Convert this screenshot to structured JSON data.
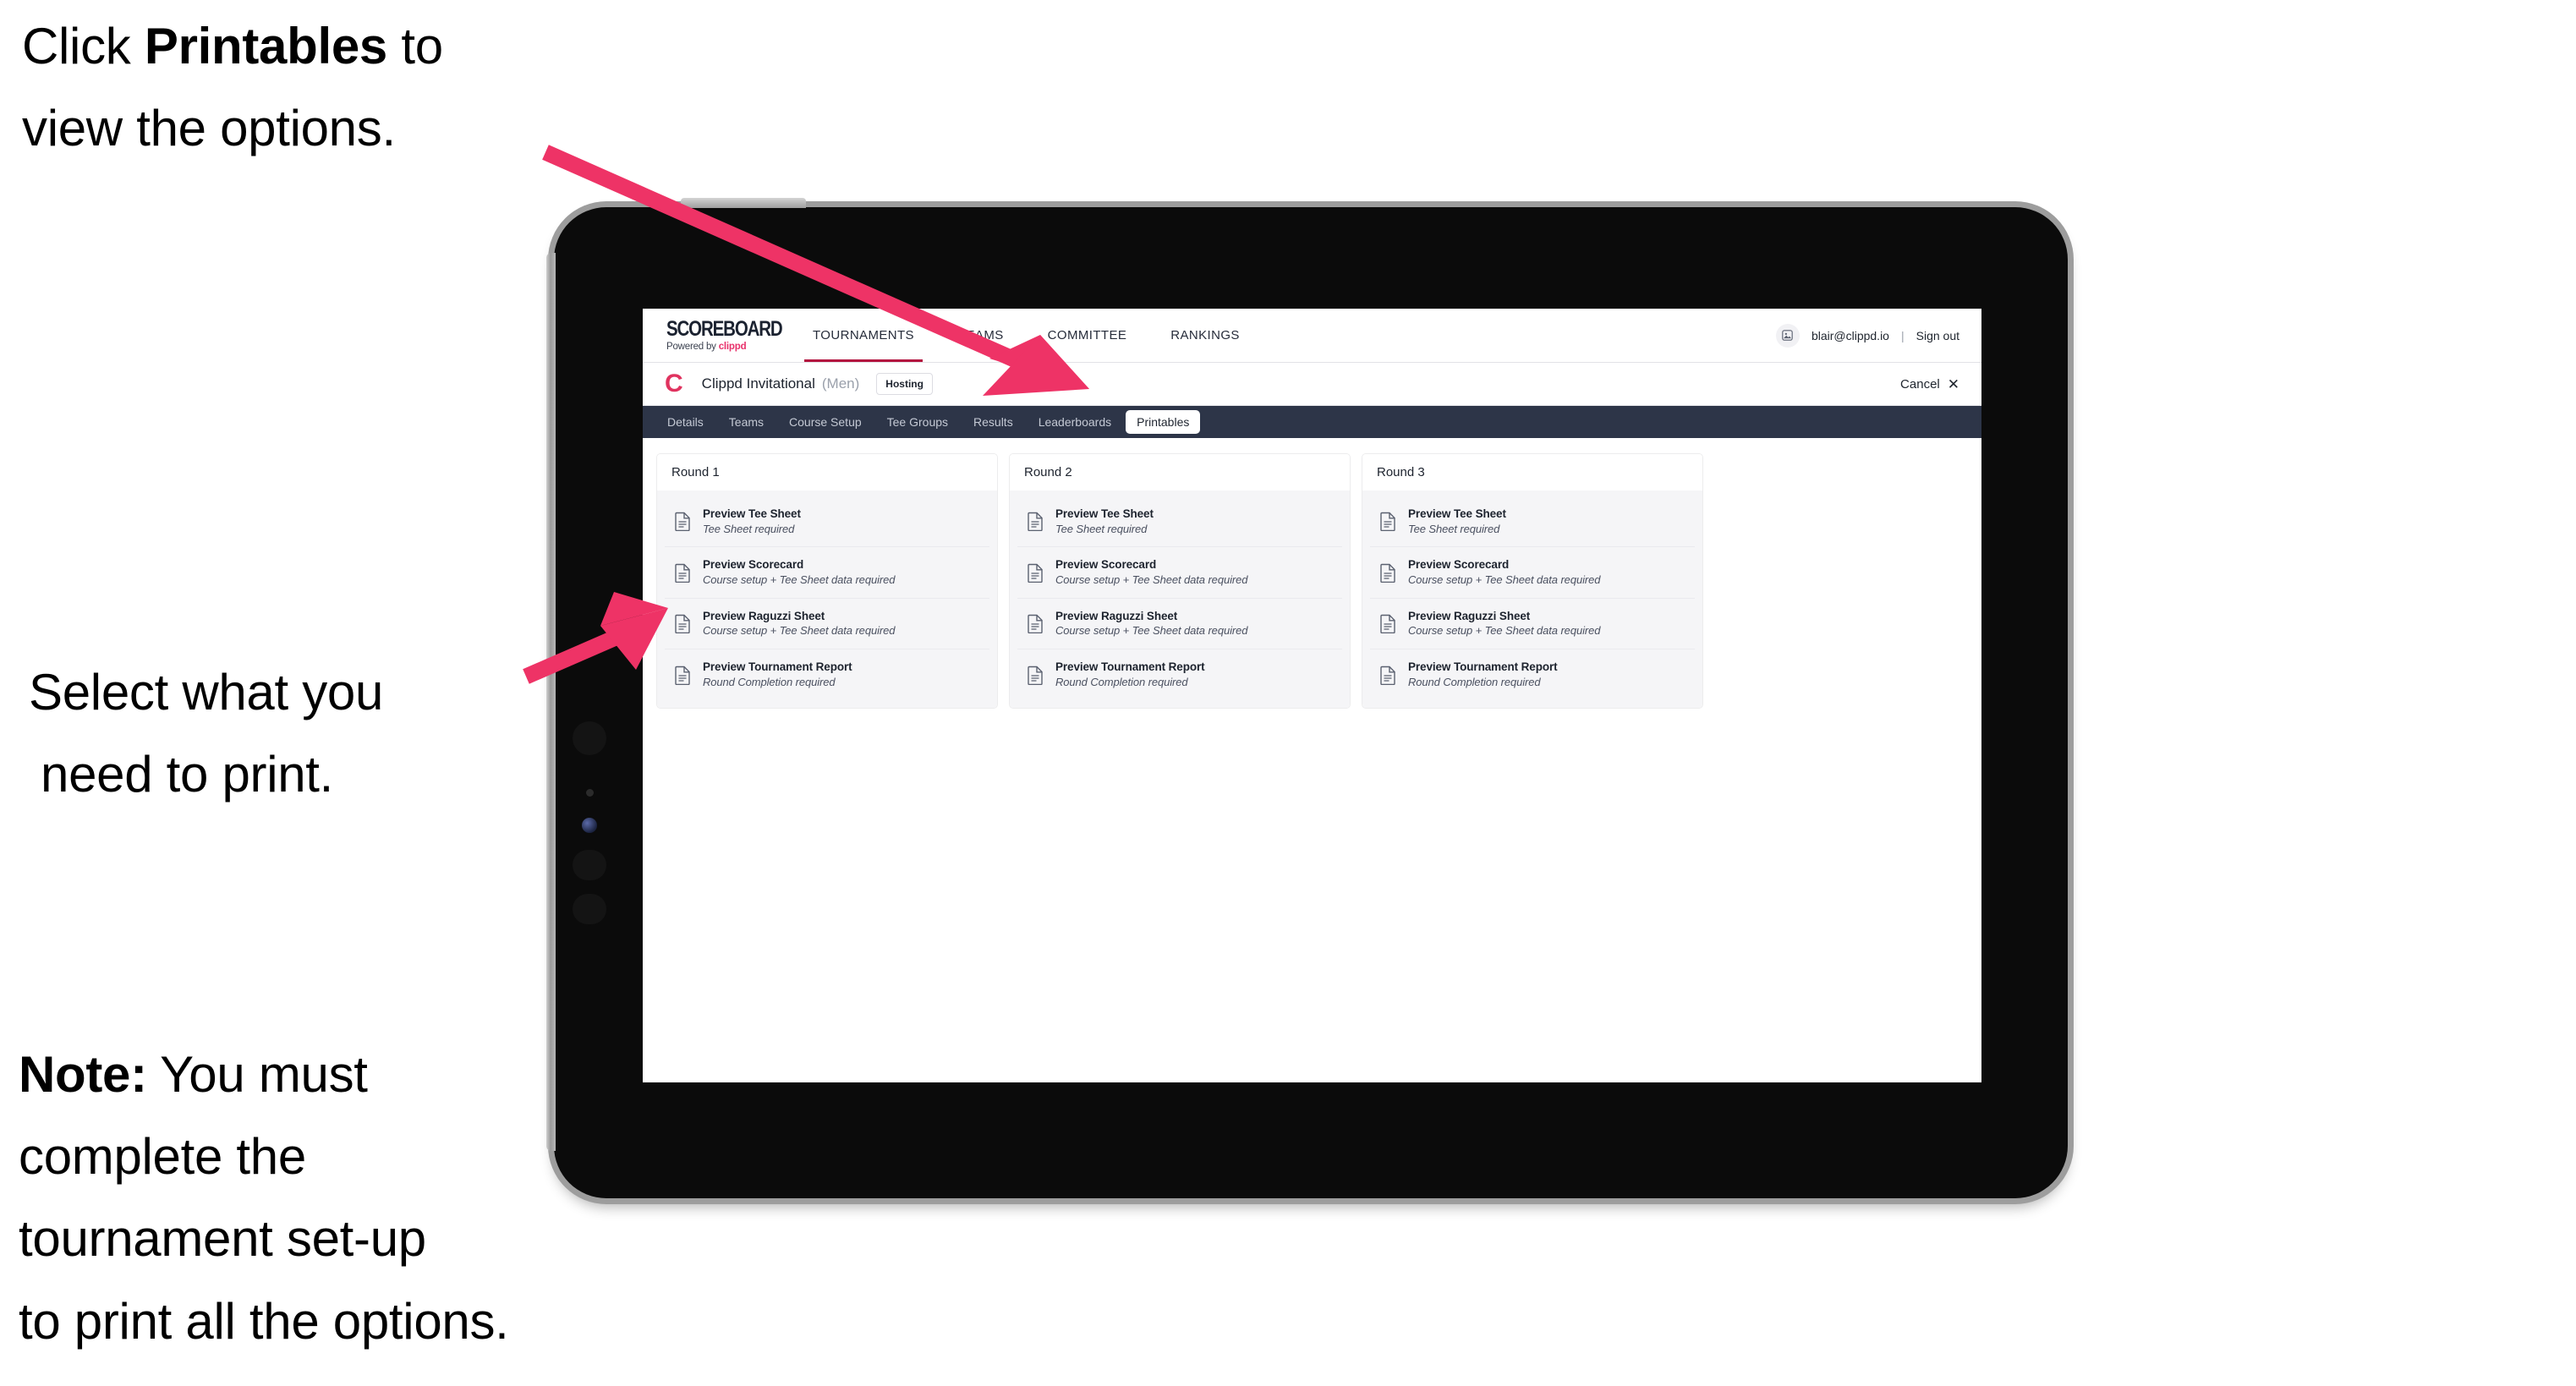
{
  "annotations": {
    "top": "Click Printables to\nview the options.",
    "top_prefix": "Click ",
    "top_bold": "Printables",
    "top_suffix": " to",
    "top_line2": "view the options.",
    "middle_line1": "Select what you",
    "middle_line2": "need to print.",
    "note_bold": "Note:",
    "note_rest": " You must",
    "note_line2": "complete the",
    "note_line3": "tournament set-up",
    "note_line4": "to print all the options."
  },
  "app": {
    "logo": {
      "word": "SCOREBOARD",
      "powered_by": "Powered by ",
      "brand": "clippd"
    },
    "topnav": [
      {
        "label": "TOURNAMENTS",
        "active": true
      },
      {
        "label": "TEAMS",
        "active": false
      },
      {
        "label": "COMMITTEE",
        "active": false
      },
      {
        "label": "RANKINGS",
        "active": false
      }
    ],
    "account": {
      "avatar_icon": "user-avatar-icon",
      "email": "blair@clippd.io",
      "separator": "|",
      "sign_out": "Sign out"
    },
    "tournament": {
      "logo_letter": "C",
      "name": "Clippd Invitational",
      "gender": "(Men)",
      "status_badge": "Hosting",
      "cancel_label": "Cancel",
      "cancel_icon": "close-icon"
    },
    "tabs": [
      {
        "label": "Details",
        "active": false
      },
      {
        "label": "Teams",
        "active": false
      },
      {
        "label": "Course Setup",
        "active": false
      },
      {
        "label": "Tee Groups",
        "active": false
      },
      {
        "label": "Results",
        "active": false
      },
      {
        "label": "Leaderboards",
        "active": false
      },
      {
        "label": "Printables",
        "active": true
      }
    ],
    "rounds": [
      {
        "title": "Round 1",
        "items": [
          {
            "icon": "document-icon",
            "title": "Preview Tee Sheet",
            "subtitle": "Tee Sheet required"
          },
          {
            "icon": "document-icon",
            "title": "Preview Scorecard",
            "subtitle": "Course setup + Tee Sheet data required"
          },
          {
            "icon": "document-icon",
            "title": "Preview Raguzzi Sheet",
            "subtitle": "Course setup + Tee Sheet data required"
          },
          {
            "icon": "document-icon",
            "title": "Preview Tournament Report",
            "subtitle": "Round Completion required"
          }
        ]
      },
      {
        "title": "Round 2",
        "items": [
          {
            "icon": "document-icon",
            "title": "Preview Tee Sheet",
            "subtitle": "Tee Sheet required"
          },
          {
            "icon": "document-icon",
            "title": "Preview Scorecard",
            "subtitle": "Course setup + Tee Sheet data required"
          },
          {
            "icon": "document-icon",
            "title": "Preview Raguzzi Sheet",
            "subtitle": "Course setup + Tee Sheet data required"
          },
          {
            "icon": "document-icon",
            "title": "Preview Tournament Report",
            "subtitle": "Round Completion required"
          }
        ]
      },
      {
        "title": "Round 3",
        "items": [
          {
            "icon": "document-icon",
            "title": "Preview Tee Sheet",
            "subtitle": "Tee Sheet required"
          },
          {
            "icon": "document-icon",
            "title": "Preview Scorecard",
            "subtitle": "Course setup + Tee Sheet data required"
          },
          {
            "icon": "document-icon",
            "title": "Preview Raguzzi Sheet",
            "subtitle": "Course setup + Tee Sheet data required"
          },
          {
            "icon": "document-icon",
            "title": "Preview Tournament Report",
            "subtitle": "Round Completion required"
          }
        ]
      }
    ]
  },
  "colors": {
    "arrow": "#EE3366",
    "brand_pink": "#E8316B",
    "tabstrip": "#2D3548",
    "active_underline": "#B3123F",
    "card_bg": "#F5F5F7"
  }
}
